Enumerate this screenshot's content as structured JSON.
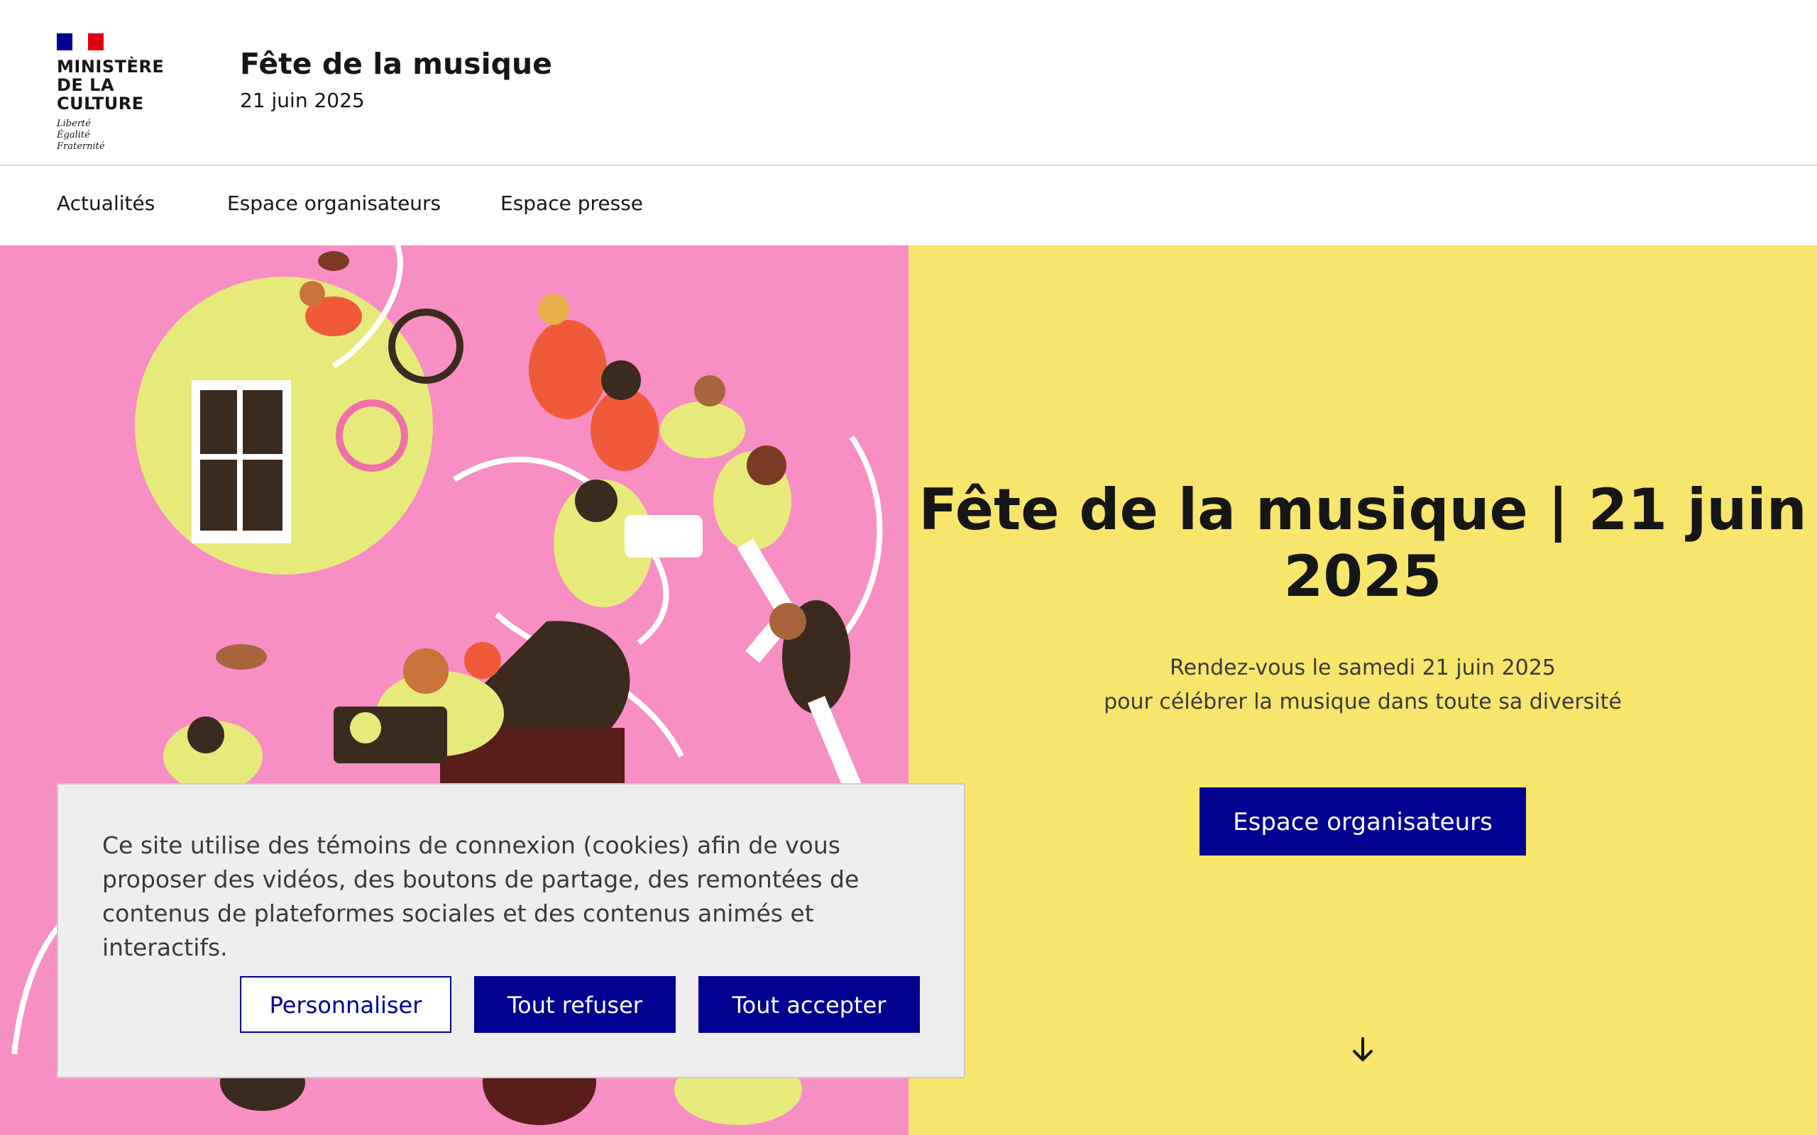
{
  "header": {
    "logo_lines": [
      "MINISTÈRE",
      "DE LA CULTURE"
    ],
    "motto_lines": [
      "Liberté",
      "Égalité",
      "Fraternité"
    ],
    "site_title": "Fête de la musique",
    "site_tagline": "21 juin 2025"
  },
  "nav": {
    "items": [
      {
        "label": "Actualités"
      },
      {
        "label": "Espace organisateurs"
      },
      {
        "label": "Espace presse"
      }
    ]
  },
  "hero": {
    "title_bold": "Fête de la musique |",
    "title_regular": " 21 juin 2025",
    "text_lines": [
      "Rendez-vous le samedi 21 juin 2025",
      "pour célébrer la musique dans toute sa diversité"
    ],
    "button_label": "Espace organisateurs",
    "scroll_icon": "arrow-down-icon",
    "illustration": "festival-crowd-illustration"
  },
  "cookie_banner": {
    "text": "Ce site utilise des témoins de connexion (cookies) afin de vous proposer des vidéos, des boutons de partage, des remontées de contenus de plateformes sociales et des contenus animés et interactifs.",
    "customize_label": "Personnaliser",
    "refuse_label": "Tout refuser",
    "accept_label": "Tout accepter"
  },
  "colors": {
    "brand_blue": "#000091",
    "hero_pink": "#f78ec4",
    "hero_yellow": "#f8e56c",
    "marianne_red": "#e1000f"
  }
}
